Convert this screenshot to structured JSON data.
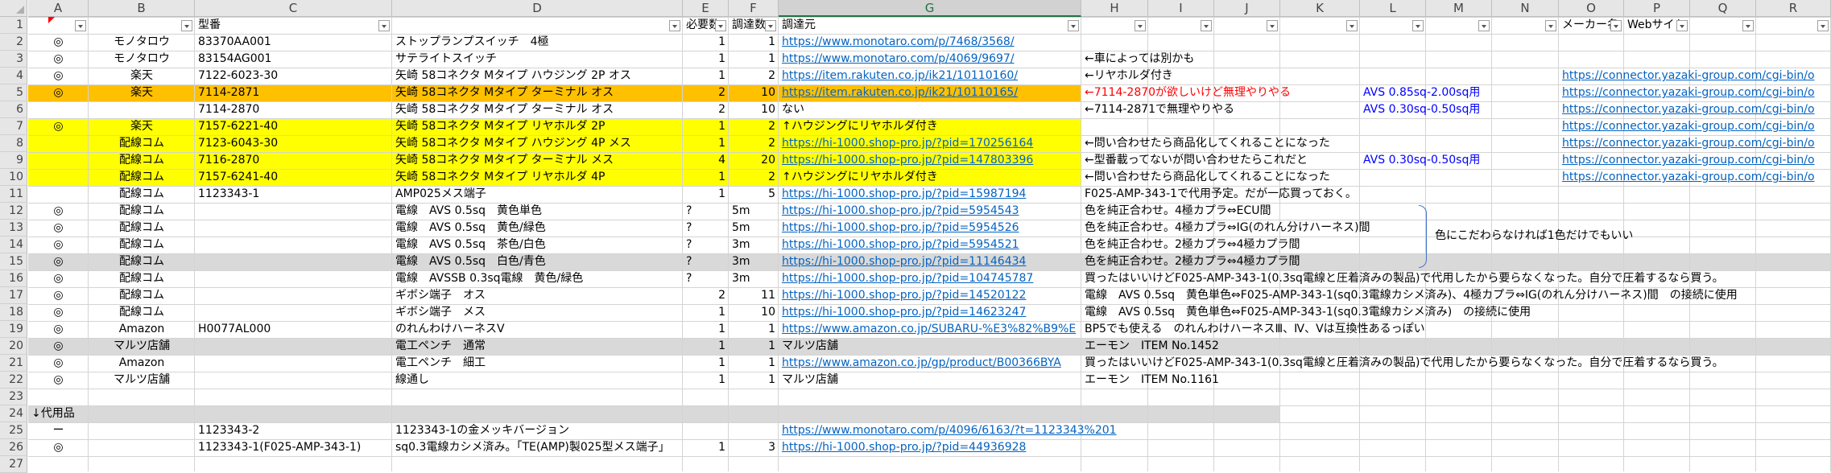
{
  "columns": [
    "A",
    "B",
    "C",
    "D",
    "E",
    "F",
    "G",
    "H",
    "I",
    "J",
    "K",
    "L",
    "M",
    "N",
    "O",
    "P",
    "Q",
    "R"
  ],
  "header_row": {
    "A": "",
    "B": "",
    "C": "型番",
    "D": "",
    "E": "必要数",
    "F": "調達数",
    "G": "調達元",
    "H": "",
    "I": "",
    "J": "",
    "K": "",
    "L": "",
    "M": "",
    "N": "",
    "O": "メーカー名",
    "P": "Webサイト",
    "Q": "",
    "R": ""
  },
  "rows": [
    {
      "num": "2",
      "A": "◎",
      "B": "モノタロウ",
      "C": "83370AA001",
      "D": "ストップランプスイッチ　4極",
      "E": "1",
      "F": "1",
      "G": "https://www.monotaro.com/p/7468/3568/",
      "H": "",
      "L": "",
      "O": ""
    },
    {
      "num": "3",
      "A": "◎",
      "B": "モノタロウ",
      "C": "83154AG001",
      "D": "サテライトスイッチ",
      "E": "1",
      "F": "1",
      "G": "https://www.monotaro.com/p/4069/9697/",
      "H": "←車によっては別かも",
      "L": "",
      "O": ""
    },
    {
      "num": "4",
      "A": "◎",
      "B": "楽天",
      "C": "7122-6023-30",
      "D": "矢崎 58コネクタ Mタイプ ハウジング 2P オス",
      "E": "1",
      "F": "2",
      "G": "https://item.rakuten.co.jp/ik21/10110160/",
      "H": "←リヤホルダ付き",
      "L": "",
      "O": "https://connector.yazaki-group.com/cgi-bin/o"
    },
    {
      "num": "5",
      "A": "◎",
      "B": "楽天",
      "C": "7114-2871",
      "D": "矢崎 58コネクタ Mタイプ ターミナル オス",
      "E": "2",
      "F": "10",
      "G": "https://item.rakuten.co.jp/ik21/10110165/",
      "H": "←7114-2870が欲しいけど無理やりやる",
      "L": "AVS  0.85sq-2.00sq用",
      "O": "https://connector.yazaki-group.com/cgi-bin/o"
    },
    {
      "num": "6",
      "A": "",
      "B": "",
      "C": "7114-2870",
      "D": "矢崎 58コネクタ Mタイプ ターミナル オス",
      "E": "2",
      "F": "10",
      "G": "ない",
      "H": "←7114-2871で無理やりやる",
      "L": "AVS  0.30sq-0.50sq用",
      "O": "https://connector.yazaki-group.com/cgi-bin/o"
    },
    {
      "num": "7",
      "A": "◎",
      "B": "楽天",
      "C": "7157-6221-40",
      "D": "矢崎 58コネクタ Mタイプ リヤホルダ 2P",
      "E": "1",
      "F": "2",
      "G": "↑ハウジングにリヤホルダ付き",
      "H": "",
      "L": "",
      "O": "https://connector.yazaki-group.com/cgi-bin/o"
    },
    {
      "num": "8",
      "A": "",
      "B": "配線コム",
      "C": "7123-6043-30",
      "D": "矢崎 58コネクタ Mタイプ ハウジング 4P メス",
      "E": "1",
      "F": "2",
      "G": "https://hi-1000.shop-pro.jp/?pid=170256164",
      "H": "←問い合わせたら商品化してくれることになった",
      "L": "",
      "O": "https://connector.yazaki-group.com/cgi-bin/o"
    },
    {
      "num": "9",
      "A": "",
      "B": "配線コム",
      "C": "7116-2870",
      "D": "矢崎 58コネクタ Mタイプ ターミナル メス",
      "E": "4",
      "F": "20",
      "G": "https://hi-1000.shop-pro.jp/?pid=147803396",
      "H": "←型番載ってないが問い合わせたらこれだと",
      "L": "AVS  0.30sq-0.50sq用",
      "O": "https://connector.yazaki-group.com/cgi-bin/o"
    },
    {
      "num": "10",
      "A": "",
      "B": "配線コム",
      "C": "7157-6241-40",
      "D": "矢崎 58コネクタ Mタイプ リヤホルダ 4P",
      "E": "1",
      "F": "2",
      "G": "↑ハウジングにリヤホルダ付き",
      "H": "←問い合わせたら商品化してくれることになった",
      "L": "",
      "O": "https://connector.yazaki-group.com/cgi-bin/o"
    },
    {
      "num": "11",
      "A": "",
      "B": "配線コム",
      "C": "1123343-1",
      "D": "AMP025メス端子",
      "E": "1",
      "F": "5",
      "G": "https://hi-1000.shop-pro.jp/?pid=15987194",
      "H": "F025-AMP-343-1で代用予定。だが一応買っておく。",
      "L": "",
      "O": ""
    },
    {
      "num": "12",
      "A": "◎",
      "B": "配線コム",
      "C": "",
      "D": "電線　AVS 0.5sq　黄色単色",
      "E": "?",
      "F": "5m",
      "G": "https://hi-1000.shop-pro.jp/?pid=5954543",
      "H": "色を純正合わせ。4極カプラ⇔ECU間",
      "L": "",
      "O": ""
    },
    {
      "num": "13",
      "A": "◎",
      "B": "配線コム",
      "C": "",
      "D": "電線　AVS 0.5sq　黄色/緑色",
      "E": "?",
      "F": "5m",
      "G": "https://hi-1000.shop-pro.jp/?pid=5954526",
      "H": "色を純正合わせ。4極カプラ⇔IG(のれん分けハーネス)間",
      "L": "",
      "O": ""
    },
    {
      "num": "14",
      "A": "◎",
      "B": "配線コム",
      "C": "",
      "D": "電線　AVS 0.5sq　茶色/白色",
      "E": "?",
      "F": "3m",
      "G": "https://hi-1000.shop-pro.jp/?pid=5954521",
      "H": "色を純正合わせ。2極カプラ⇔4極カプラ間",
      "L": "",
      "O": ""
    },
    {
      "num": "15",
      "A": "◎",
      "B": "配線コム",
      "C": "",
      "D": "電線　AVS 0.5sq　白色/青色",
      "E": "?",
      "F": "3m",
      "G": "https://hi-1000.shop-pro.jp/?pid=11146434",
      "H": "色を純正合わせ。2極カプラ⇔4極カプラ間",
      "L": "",
      "O": ""
    },
    {
      "num": "16",
      "A": "◎",
      "B": "配線コム",
      "C": "",
      "D": "電線　AVSSB 0.3sq電線　黄色/緑色",
      "E": "?",
      "F": "3m",
      "G": "https://hi-1000.shop-pro.jp/?pid=104745787",
      "H": "買ったはいいけどF025-AMP-343-1(0.3sq電線と圧着済みの製品)で代用したから要らなくなった。自分で圧着するなら買う。",
      "L": "",
      "O": ""
    },
    {
      "num": "17",
      "A": "◎",
      "B": "配線コム",
      "C": "",
      "D": "ギボシ端子　オス",
      "E": "2",
      "F": "11",
      "G": "https://hi-1000.shop-pro.jp/?pid=14520122",
      "H": "電線　AVS 0.5sq　黄色単色⇔F025-AMP-343-1(sq0.3電線カシメ済み)、4極カプラ⇔IG(のれん分けハーネス)間　の接続に使用",
      "L": "",
      "O": ""
    },
    {
      "num": "18",
      "A": "◎",
      "B": "配線コム",
      "C": "",
      "D": "ギボシ端子　メス",
      "E": "1",
      "F": "10",
      "G": "https://hi-1000.shop-pro.jp/?pid=14623247",
      "H": "電線　AVS 0.5sq　黄色単色⇔F025-AMP-343-1(sq0.3電線カシメ済み)　の接続に使用",
      "L": "",
      "O": ""
    },
    {
      "num": "19",
      "A": "◎",
      "B": "Amazon",
      "C": "H0077AL000",
      "D": "のれんわけハーネスⅤ",
      "E": "1",
      "F": "1",
      "G": "https://www.amazon.co.jp/SUBARU-%E3%82%B9%E",
      "H": "BP5でも使える　のれんわけハーネスⅢ、Ⅳ、Ⅴは互換性あるっぽい",
      "L": "",
      "O": ""
    },
    {
      "num": "20",
      "A": "◎",
      "B": "マルツ店舗",
      "C": "",
      "D": "電工ペンチ　通常",
      "E": "1",
      "F": "1",
      "G": "マルツ店舗",
      "H": "エーモン　ITEM No.1452",
      "L": "",
      "O": ""
    },
    {
      "num": "21",
      "A": "◎",
      "B": "Amazon",
      "C": "",
      "D": "電工ペンチ　細工",
      "E": "1",
      "F": "1",
      "G": "https://www.amazon.co.jp/gp/product/B00366BYA",
      "H": "買ったはいいけどF025-AMP-343-1(0.3sq電線と圧着済みの製品)で代用したから要らなくなった。自分で圧着するなら買う。",
      "L": "",
      "O": ""
    },
    {
      "num": "22",
      "A": "◎",
      "B": "マルツ店舗",
      "C": "",
      "D": "線通し",
      "E": "1",
      "F": "1",
      "G": "マルツ店舗",
      "H": "エーモン　ITEM No.1161",
      "L": "",
      "O": ""
    },
    {
      "num": "23",
      "A": "",
      "B": "",
      "C": "",
      "D": "",
      "E": "",
      "F": "",
      "G": "",
      "H": "",
      "L": "",
      "O": ""
    },
    {
      "num": "24",
      "A": "↓代用品",
      "B": "",
      "C": "",
      "D": "",
      "E": "",
      "F": "",
      "G": "",
      "H": "",
      "L": "",
      "O": ""
    },
    {
      "num": "25",
      "A": "ー",
      "B": "",
      "C": "1123343-2",
      "D": "1123343-1の金メッキバージョン",
      "E": "",
      "F": "",
      "G": "https://www.monotaro.com/p/4096/6163/?t=1123343%201",
      "H": "",
      "L": "",
      "O": ""
    },
    {
      "num": "26",
      "A": "◎",
      "B": "",
      "C": "1123343-1(F025-AMP-343-1)",
      "D": "sq0.3電線カシメ済み。「TE(AMP)製025型メス端子」",
      "E": "1",
      "F": "3",
      "G": "https://hi-1000.shop-pro.jp/?pid=44936928",
      "H": "",
      "L": "",
      "O": ""
    }
  ],
  "brace_note": "色にこだわらなければ1色だけでもいい",
  "colors": {
    "yellow": "#ffff00",
    "orange": "#ffc000",
    "gray": "#d9d9d9",
    "link": "#0563c1",
    "red": "#ff0000",
    "blue": "#0000ff",
    "header_bg": "#e6e6e6"
  }
}
